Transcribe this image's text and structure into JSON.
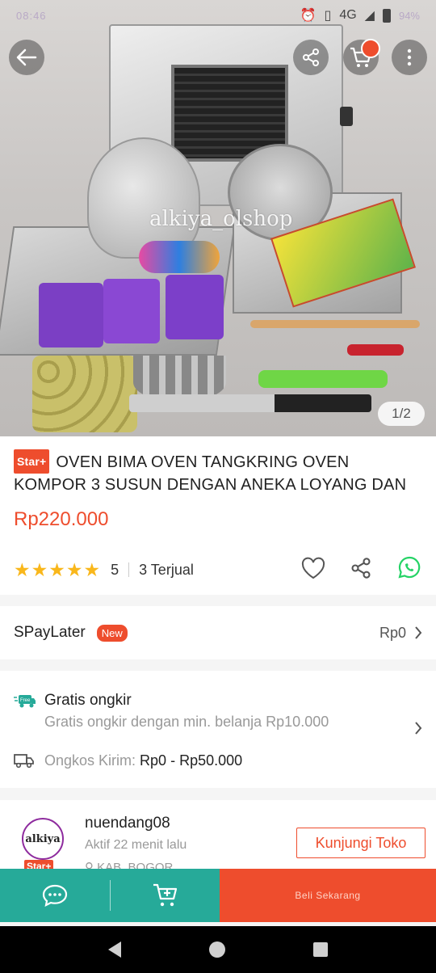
{
  "status_bar": {
    "left_text": "08:46",
    "network": "4G",
    "battery_pct": "94%"
  },
  "hero": {
    "watermark": "alkiya_olshop",
    "image_counter": "1/2",
    "cart_badge_count": ""
  },
  "product": {
    "badge": "Star+",
    "title": "OVEN BIMA OVEN TANGKRING OVEN KOMPOR 3 SUSUN DENGAN ANEKA LOYANG DAN",
    "price": "Rp220.000",
    "rating_stars": "★★★★★",
    "rating_value": "5",
    "sold": "3 Terjual"
  },
  "spaylater": {
    "label": "SPayLater",
    "badge": "New",
    "value": "Rp0"
  },
  "shipping": {
    "free_icon_text": "Free",
    "title": "Gratis ongkir",
    "subtitle": "Gratis ongkir dengan min. belanja Rp10.000",
    "cost_label": "Ongkos Kirim:",
    "cost_value": "Rp0 - Rp50.000"
  },
  "shop": {
    "avatar_text": "alkiya",
    "badge": "Star+",
    "name": "nuendang08",
    "active": "Aktif 22 menit lalu",
    "location": "KAB. BOGOR",
    "visit_label": "Kunjungi Toko"
  },
  "bottom_bar": {
    "buy_label": "Beli Sekarang"
  },
  "colors": {
    "accent": "#ee4d2d",
    "teal": "#26aa99",
    "star": "#f9b71b",
    "whatsapp": "#25d366"
  }
}
